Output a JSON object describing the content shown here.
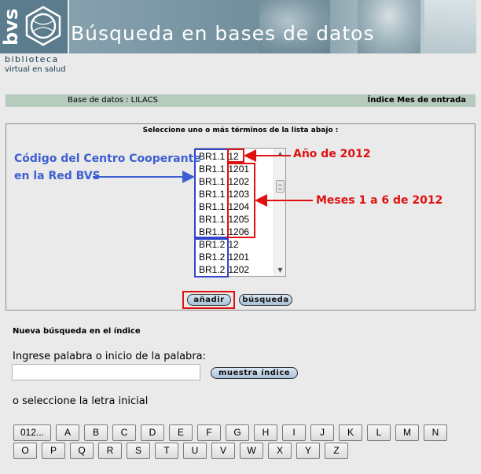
{
  "header": {
    "logo_text": "bvs",
    "logo_line1": "biblioteca",
    "logo_line2": "virtual en salud",
    "title": "Búsqueda en bases de datos"
  },
  "db_bar": {
    "database": "Base de datos : LILACS",
    "index": "Índice Mes de entrada"
  },
  "selection": {
    "instruction": "Seleccione uno o más términos de la lista abajo :",
    "list_items": [
      {
        "prefix": "BR1.1",
        "code": "12"
      },
      {
        "prefix": "BR1.1",
        "code": "1201"
      },
      {
        "prefix": "BR1.1",
        "code": "1202"
      },
      {
        "prefix": "BR1.1",
        "code": "1203"
      },
      {
        "prefix": "BR1.1",
        "code": "1204"
      },
      {
        "prefix": "BR1.1",
        "code": "1205"
      },
      {
        "prefix": "BR1.1",
        "code": "1206"
      },
      {
        "prefix": "BR1.2",
        "code": "12"
      },
      {
        "prefix": "BR1.2",
        "code": "1201"
      },
      {
        "prefix": "BR1.2",
        "code": "1202"
      }
    ],
    "add_button": "añadir",
    "search_button": "búsqueda"
  },
  "annotations": {
    "blue_line1": "Código del Centro Cooperante",
    "blue_line2": "en la Red BVS",
    "year": "Año de 2012",
    "months": "Meses 1 a 6 de 2012",
    "blue_color": "#3344cc",
    "red_color": "#dd1111"
  },
  "new_search": {
    "heading": "Nueva búsqueda en el índice",
    "input_label": "Ingrese palabra o inicio de la palabra:",
    "input_value": "",
    "show_index_button": "muestra índice",
    "letter_label": "o seleccione la letra inicial"
  },
  "letters_row1": [
    "012...",
    "A",
    "B",
    "C",
    "D",
    "E",
    "F",
    "G",
    "H",
    "I",
    "J",
    "K",
    "L",
    "M",
    "N"
  ],
  "letters_row2": [
    "O",
    "P",
    "Q",
    "R",
    "S",
    "T",
    "U",
    "V",
    "W",
    "X",
    "Y",
    "Z"
  ]
}
